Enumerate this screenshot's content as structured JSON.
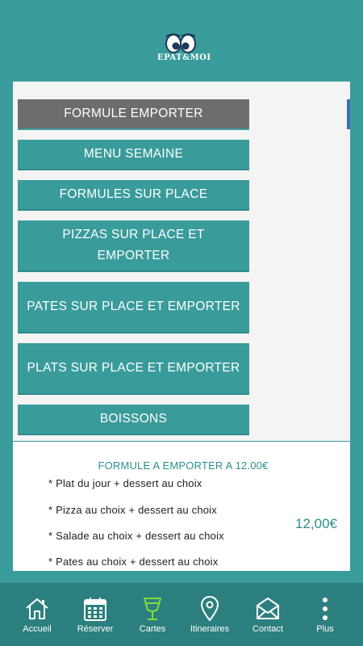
{
  "header": {
    "logo_text": "EPAT&MOI"
  },
  "menu": {
    "items": [
      {
        "label": "FORMULE EMPORTER",
        "active": true
      },
      {
        "label": "MENU SEMAINE",
        "active": false
      },
      {
        "label": "FORMULES SUR PLACE",
        "active": false
      },
      {
        "label": "PIZZAS SUR PLACE ET EMPORTER",
        "active": false
      },
      {
        "label": "PATES SUR PLACE ET EMPORTER",
        "active": false
      },
      {
        "label": "PLATS SUR PLACE ET EMPORTER",
        "active": false
      },
      {
        "label": "BOISSONS",
        "active": false
      }
    ]
  },
  "detail": {
    "title": "FORMULE A EMPORTER A 12.00€",
    "lines": [
      "* Plat du jour + dessert au choix",
      "* Pizza au choix + dessert au choix",
      "* Salade au choix + dessert au choix",
      "* Pates au choix + dessert au choix"
    ],
    "price": "12,00€"
  },
  "tabbar": {
    "tabs": [
      {
        "label": "Accueil",
        "icon": "home-icon"
      },
      {
        "label": "Réserver",
        "icon": "calendar-icon"
      },
      {
        "label": "Cartes",
        "icon": "glass-icon"
      },
      {
        "label": "Itineraires",
        "icon": "location-pin-icon"
      },
      {
        "label": "Contact",
        "icon": "envelope-icon"
      },
      {
        "label": "Plus",
        "icon": "more-vertical-icon"
      }
    ]
  },
  "colors": {
    "background": "#3a9b9b",
    "active_button": "#6d6d6d",
    "accent_text": "#2a8f8f",
    "tabbar": "#2c7f7f",
    "active_tab_icon": "#7ddc3a"
  }
}
